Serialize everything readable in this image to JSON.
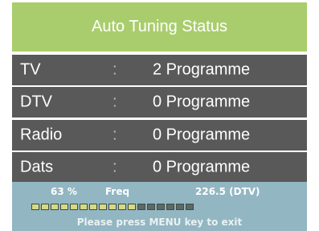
{
  "title": "Auto Tuning Status",
  "rows": [
    {
      "label": "TV",
      "sep": ":",
      "value": "2 Programme"
    },
    {
      "label": "DTV",
      "sep": ":",
      "value": "0 Programme"
    },
    {
      "label": "Radio",
      "sep": ":",
      "value": "0 Programme"
    },
    {
      "label": "Dats",
      "sep": ":",
      "value": "0 Programme"
    }
  ],
  "status": {
    "percent": "63 %",
    "freq_label": "Freq",
    "freq_value": "226.5 (DTV)",
    "progress": 0.63,
    "segments_total": 17,
    "hint": "Please press MENU key to exit"
  },
  "colors": {
    "header": "#a9cd6c",
    "row": "#595959",
    "status": "#92b6c2"
  }
}
